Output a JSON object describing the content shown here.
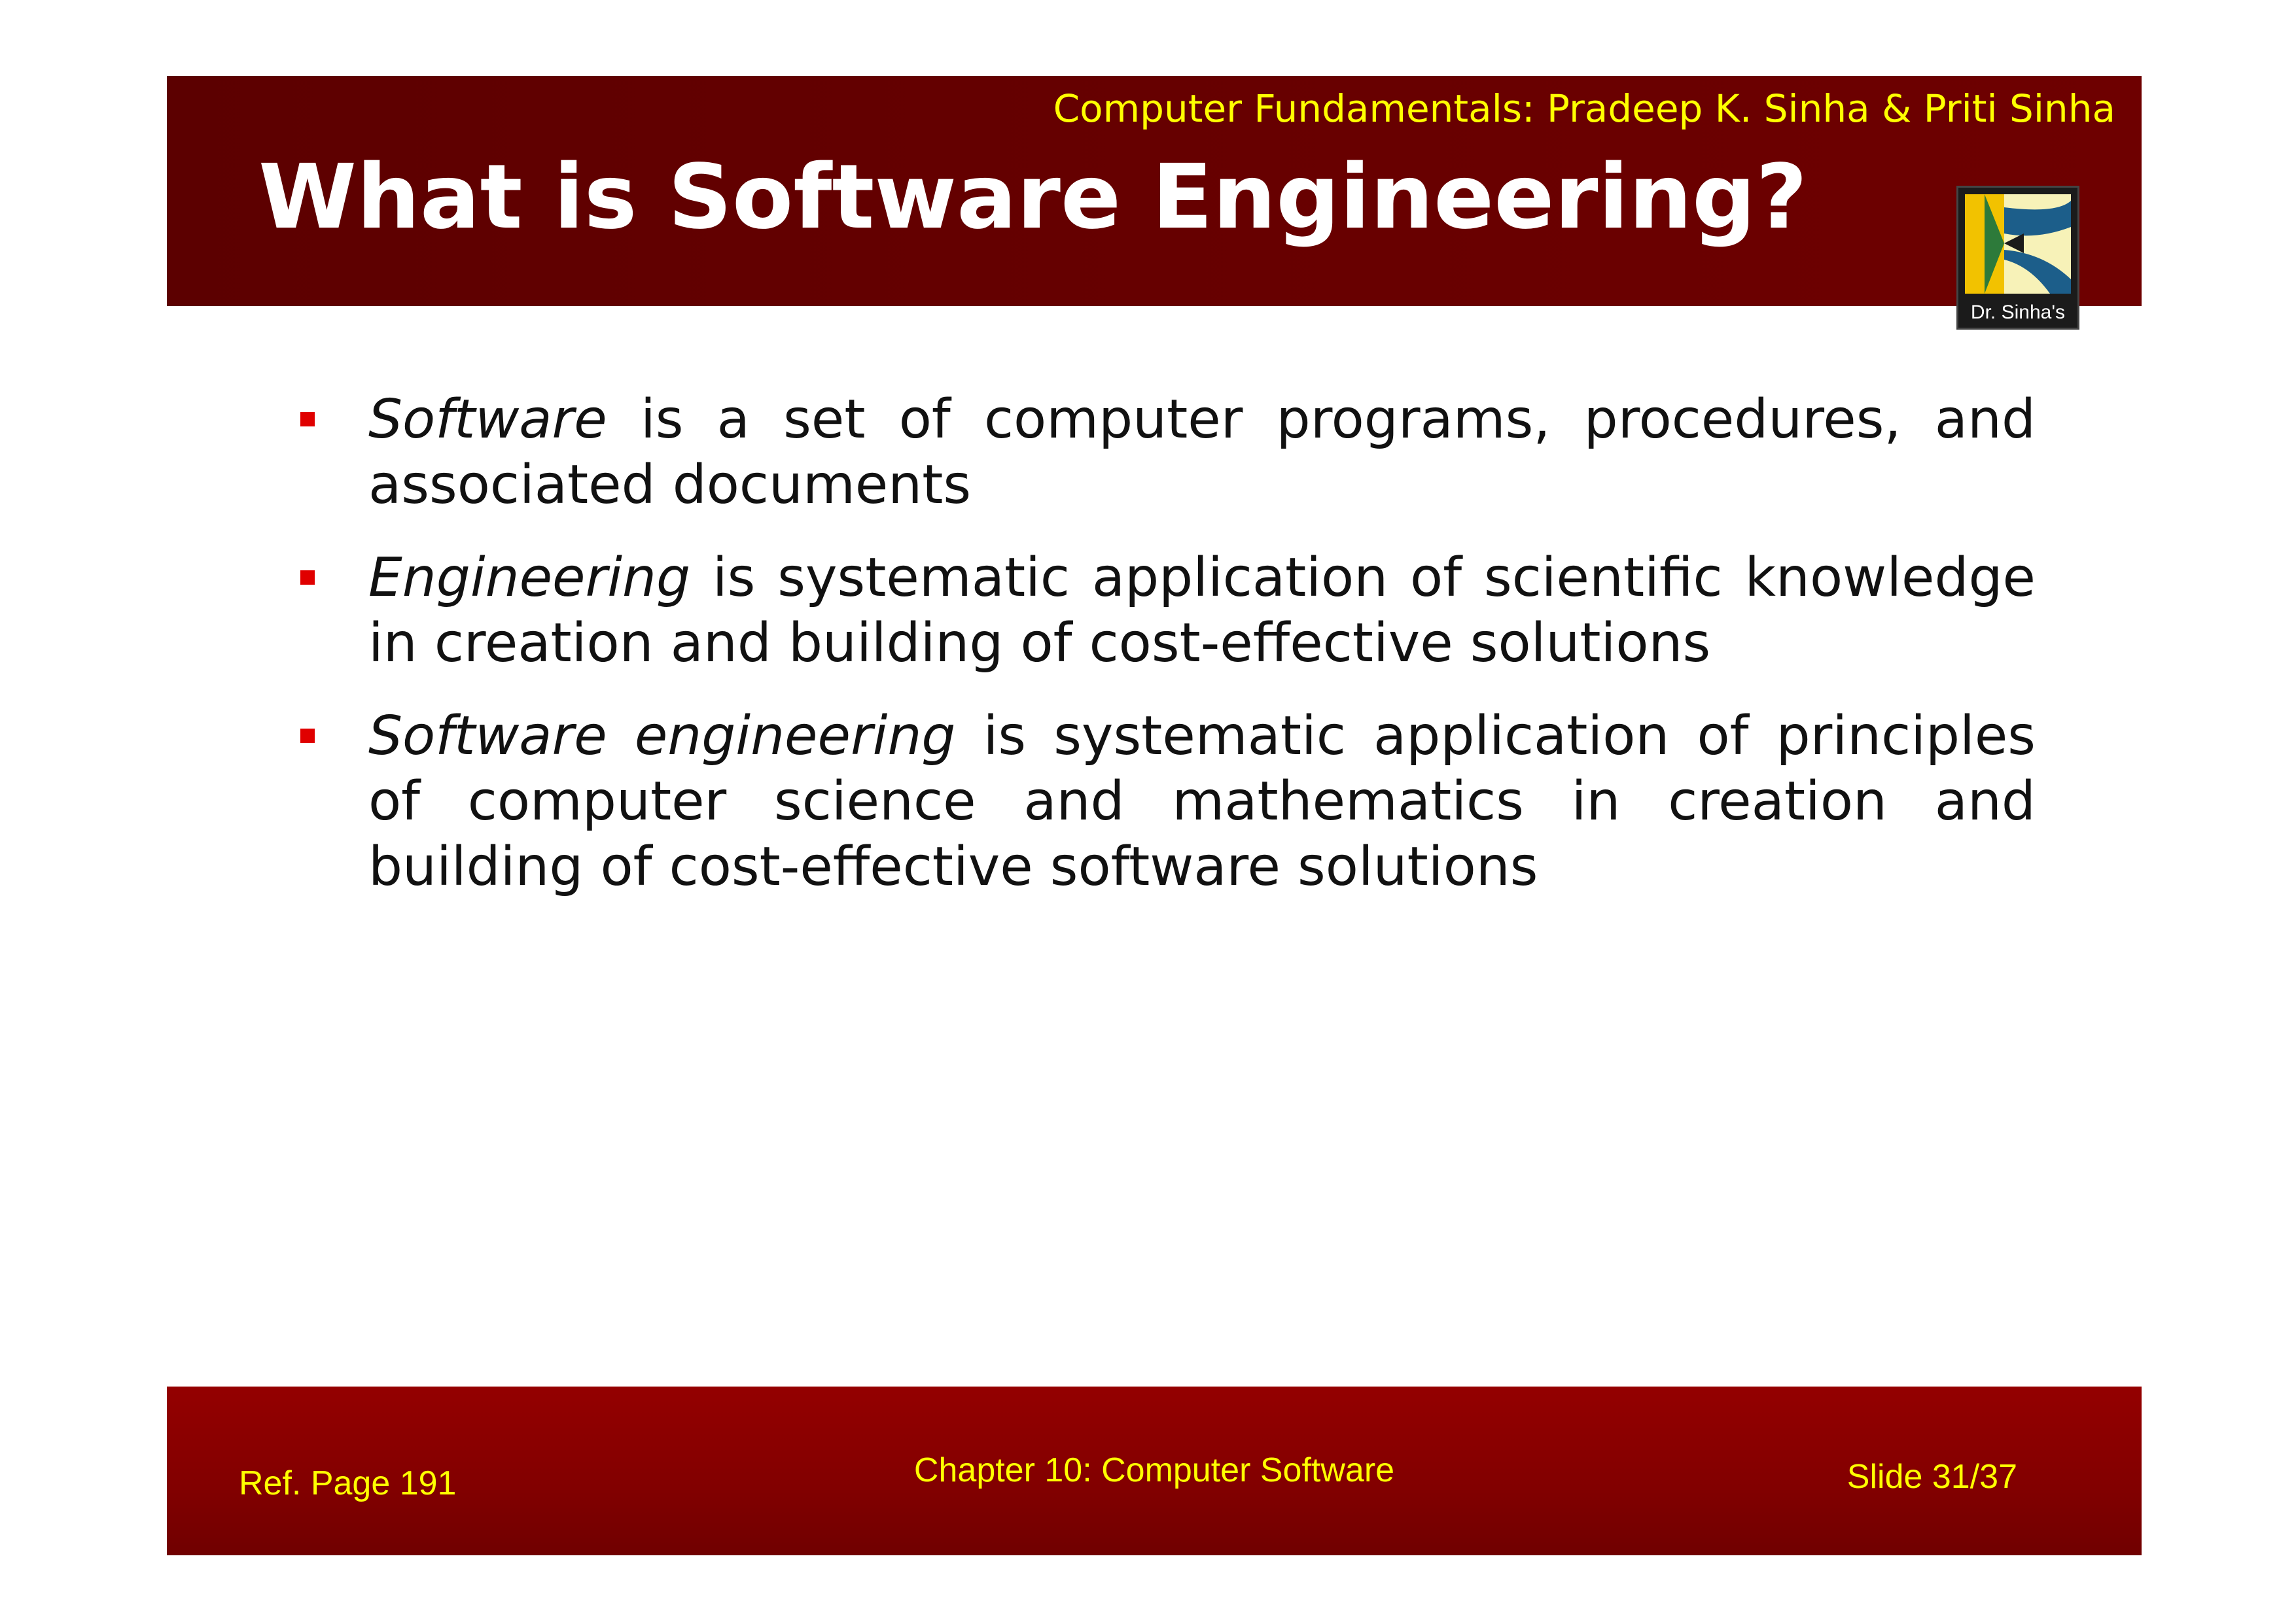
{
  "header": {
    "book_title": "Computer Fundamentals: Pradeep K. Sinha & Priti Sinha",
    "slide_title": "What is Software Engineering?",
    "logo_text": "Dr. Sinha's"
  },
  "bullets": [
    {
      "term": "Software",
      "text": " is a set of computer programs, procedures, and associated documents"
    },
    {
      "term": "Engineering",
      "text": " is systematic application of scientific knowledge in creation and building of cost-effective solutions"
    },
    {
      "term": "Software engineering",
      "text": " is systematic application of principles of computer science and mathematics in creation and building of cost-effective software solutions"
    }
  ],
  "footer": {
    "ref": "Ref. Page 191",
    "chapter": "Chapter 10: Computer Software",
    "slide": "Slide 31/37"
  },
  "colors": {
    "header_bg": "#5c0000",
    "footer_bg": "#8a0000",
    "accent_text": "#ffff00",
    "bullet": "#e00000"
  }
}
